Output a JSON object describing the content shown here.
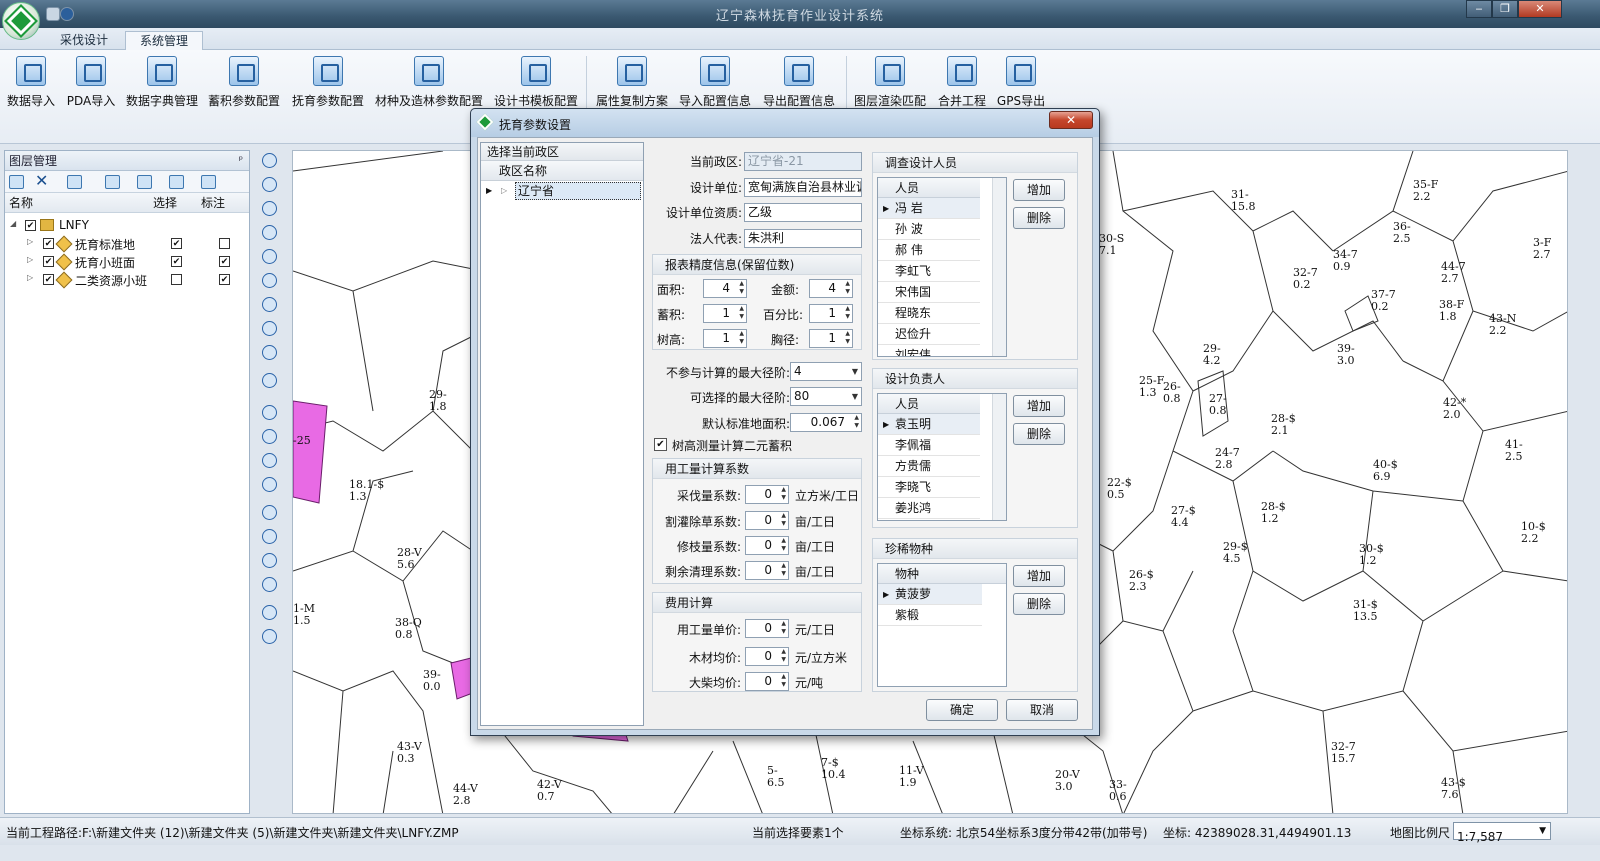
{
  "window": {
    "title": "辽宁森林抚育作业设计系统",
    "minimize_icon": "minimize-icon",
    "maximize_icon": "maximize-icon",
    "close_label": "✕"
  },
  "tabs": [
    "采伐设计",
    "系统管理"
  ],
  "ribbon": {
    "buttons": [
      "数据导入",
      "PDA导入",
      "数据字典管理",
      "蓄积参数配置",
      "抚育参数配置",
      "材种及造林参数配置",
      "设计书模板配置",
      "属性复制方案",
      "导入配置信息",
      "导出配置信息",
      "图层渲染匹配",
      "合并工程",
      "GPS导出"
    ]
  },
  "layer_panel": {
    "title": "图层管理",
    "pin": "ᵖ",
    "columns": [
      "名称",
      "选择",
      "标注"
    ],
    "root": "LNFY",
    "layers": [
      {
        "name": "抚育标准地",
        "select": true,
        "label": false
      },
      {
        "name": "抚育小班面",
        "select": true,
        "label": true
      },
      {
        "name": "二类资源小班",
        "select": false,
        "label": true
      }
    ]
  },
  "map": {
    "labels": [
      "31-\n15.8",
      "35-F\n2.2",
      "30-S\n7.1",
      "3-F\n2.7",
      "34-7\n0.9",
      "32-7\n0.2",
      "36-\n2.5",
      "44-7\n2.7",
      "37-7\n0.2",
      "38-F\n1.8",
      "43-N\n2.2",
      "39-\n3.0",
      "29-\n4.2",
      "25-F\n1.3",
      "26-\n0.8",
      "27-\n0.8",
      "42-*\n2.0",
      "28-$\n2.1",
      "41-\n2.5",
      "24-7\n2.8",
      "40-$\n6.9",
      "22-$\n0.5",
      "27-$\n4.4",
      "28-$\n1.2",
      "10-$\n2.2",
      "29-$\n4.5",
      "30-$\n1.2",
      "26-$\n2.3",
      "31-$\n13.5",
      "29-\n1.8",
      "18.1-$\n1.3",
      "28-V\n5.6",
      "38-Q\n0.8",
      "1-M\n1.5",
      "39-\n0.0",
      "43-V\n0.3",
      "44-V\n2.8",
      "42-V\n0.7",
      "5-\n6.5",
      "7-$\n10.4",
      "11-V\n1.9",
      "20-V\n3.0",
      "33-\n0.6",
      "32-7\n15.7",
      "43-$\n7.6",
      "-25"
    ]
  },
  "dialog": {
    "title": "抚育参数设置",
    "close": "✕",
    "region_panel": {
      "title": "选择当前政区",
      "column": "政区名称",
      "row": "辽宁省"
    },
    "fields": {
      "current_region_label": "当前政区:",
      "current_region": "辽宁省-21",
      "design_unit_label": "设计单位:",
      "design_unit": "宽甸满族自治县林业调",
      "qualification_label": "设计单位资质:",
      "qualification": "乙级",
      "legal_rep_label": "法人代表:",
      "legal_rep": "朱洪利"
    },
    "precision": {
      "title": "报表精度信息(保留位数)",
      "area_label": "面积:",
      "area": "4",
      "amount_label": "金额:",
      "amount": "4",
      "volume_label": "蓄积:",
      "volume": "1",
      "percent_label": "百分比:",
      "percent": "1",
      "height_label": "树高:",
      "height": "1",
      "dbh_label": "胸径:",
      "dbh": "1"
    },
    "calc": {
      "max_exclude_label": "不参与计算的最大径阶:",
      "max_exclude": "4",
      "max_select_label": "可选择的最大径阶:",
      "max_select": "80",
      "default_area_label": "默认标准地面积:",
      "default_area": "0.067",
      "binary_label": "树高测量计算二元蓄积",
      "binary_checked": true
    },
    "labor": {
      "title": "用工量计算系数",
      "rows": [
        {
          "label": "采伐量系数:",
          "value": "0",
          "unit": "立方米/工日"
        },
        {
          "label": "割灌除草系数:",
          "value": "0",
          "unit": "亩/工日"
        },
        {
          "label": "修枝量系数:",
          "value": "0",
          "unit": "亩/工日"
        },
        {
          "label": "剩余清理系数:",
          "value": "0",
          "unit": "亩/工日"
        }
      ]
    },
    "cost": {
      "title": "费用计算",
      "rows": [
        {
          "label": "用工量单价:",
          "value": "0",
          "unit": "元/工日"
        },
        {
          "label": "木材均价:",
          "value": "0",
          "unit": "元/立方米"
        },
        {
          "label": "大柴均价:",
          "value": "0",
          "unit": "元/吨"
        }
      ]
    },
    "surveyors": {
      "title": "调查设计人员",
      "column": "人员",
      "rows": [
        "冯 岩",
        "孙 波",
        "郝 伟",
        "李虹飞",
        "宋伟国",
        "程晓东",
        "迟俭升",
        "刘宏伟"
      ],
      "add": "增加",
      "delete": "删除"
    },
    "leaders": {
      "title": "设计负责人",
      "column": "人员",
      "rows": [
        "袁玉明",
        "李佩福",
        "方贵儒",
        "李晓飞",
        "姜兆鸿"
      ],
      "add": "增加",
      "delete": "删除"
    },
    "rare": {
      "title": "珍稀物种",
      "column": "物种",
      "rows": [
        "黄菠萝",
        "紫椴"
      ],
      "add": "增加",
      "delete": "删除"
    },
    "ok": "确定",
    "cancel": "取消"
  },
  "status": {
    "path": "当前工程路径:F:\\新建文件夹 (12)\\新建文件夹 (5)\\新建文件夹\\新建文件夹\\LNFY.ZMP",
    "selected": "当前选择要素1个",
    "crs": "坐标系统: 北京54坐标系3度分带42带(加带号)",
    "coords": "坐标: 42389028.31,4494901.13",
    "scale_label": "地图比例尺",
    "scale": "1:7,587"
  }
}
